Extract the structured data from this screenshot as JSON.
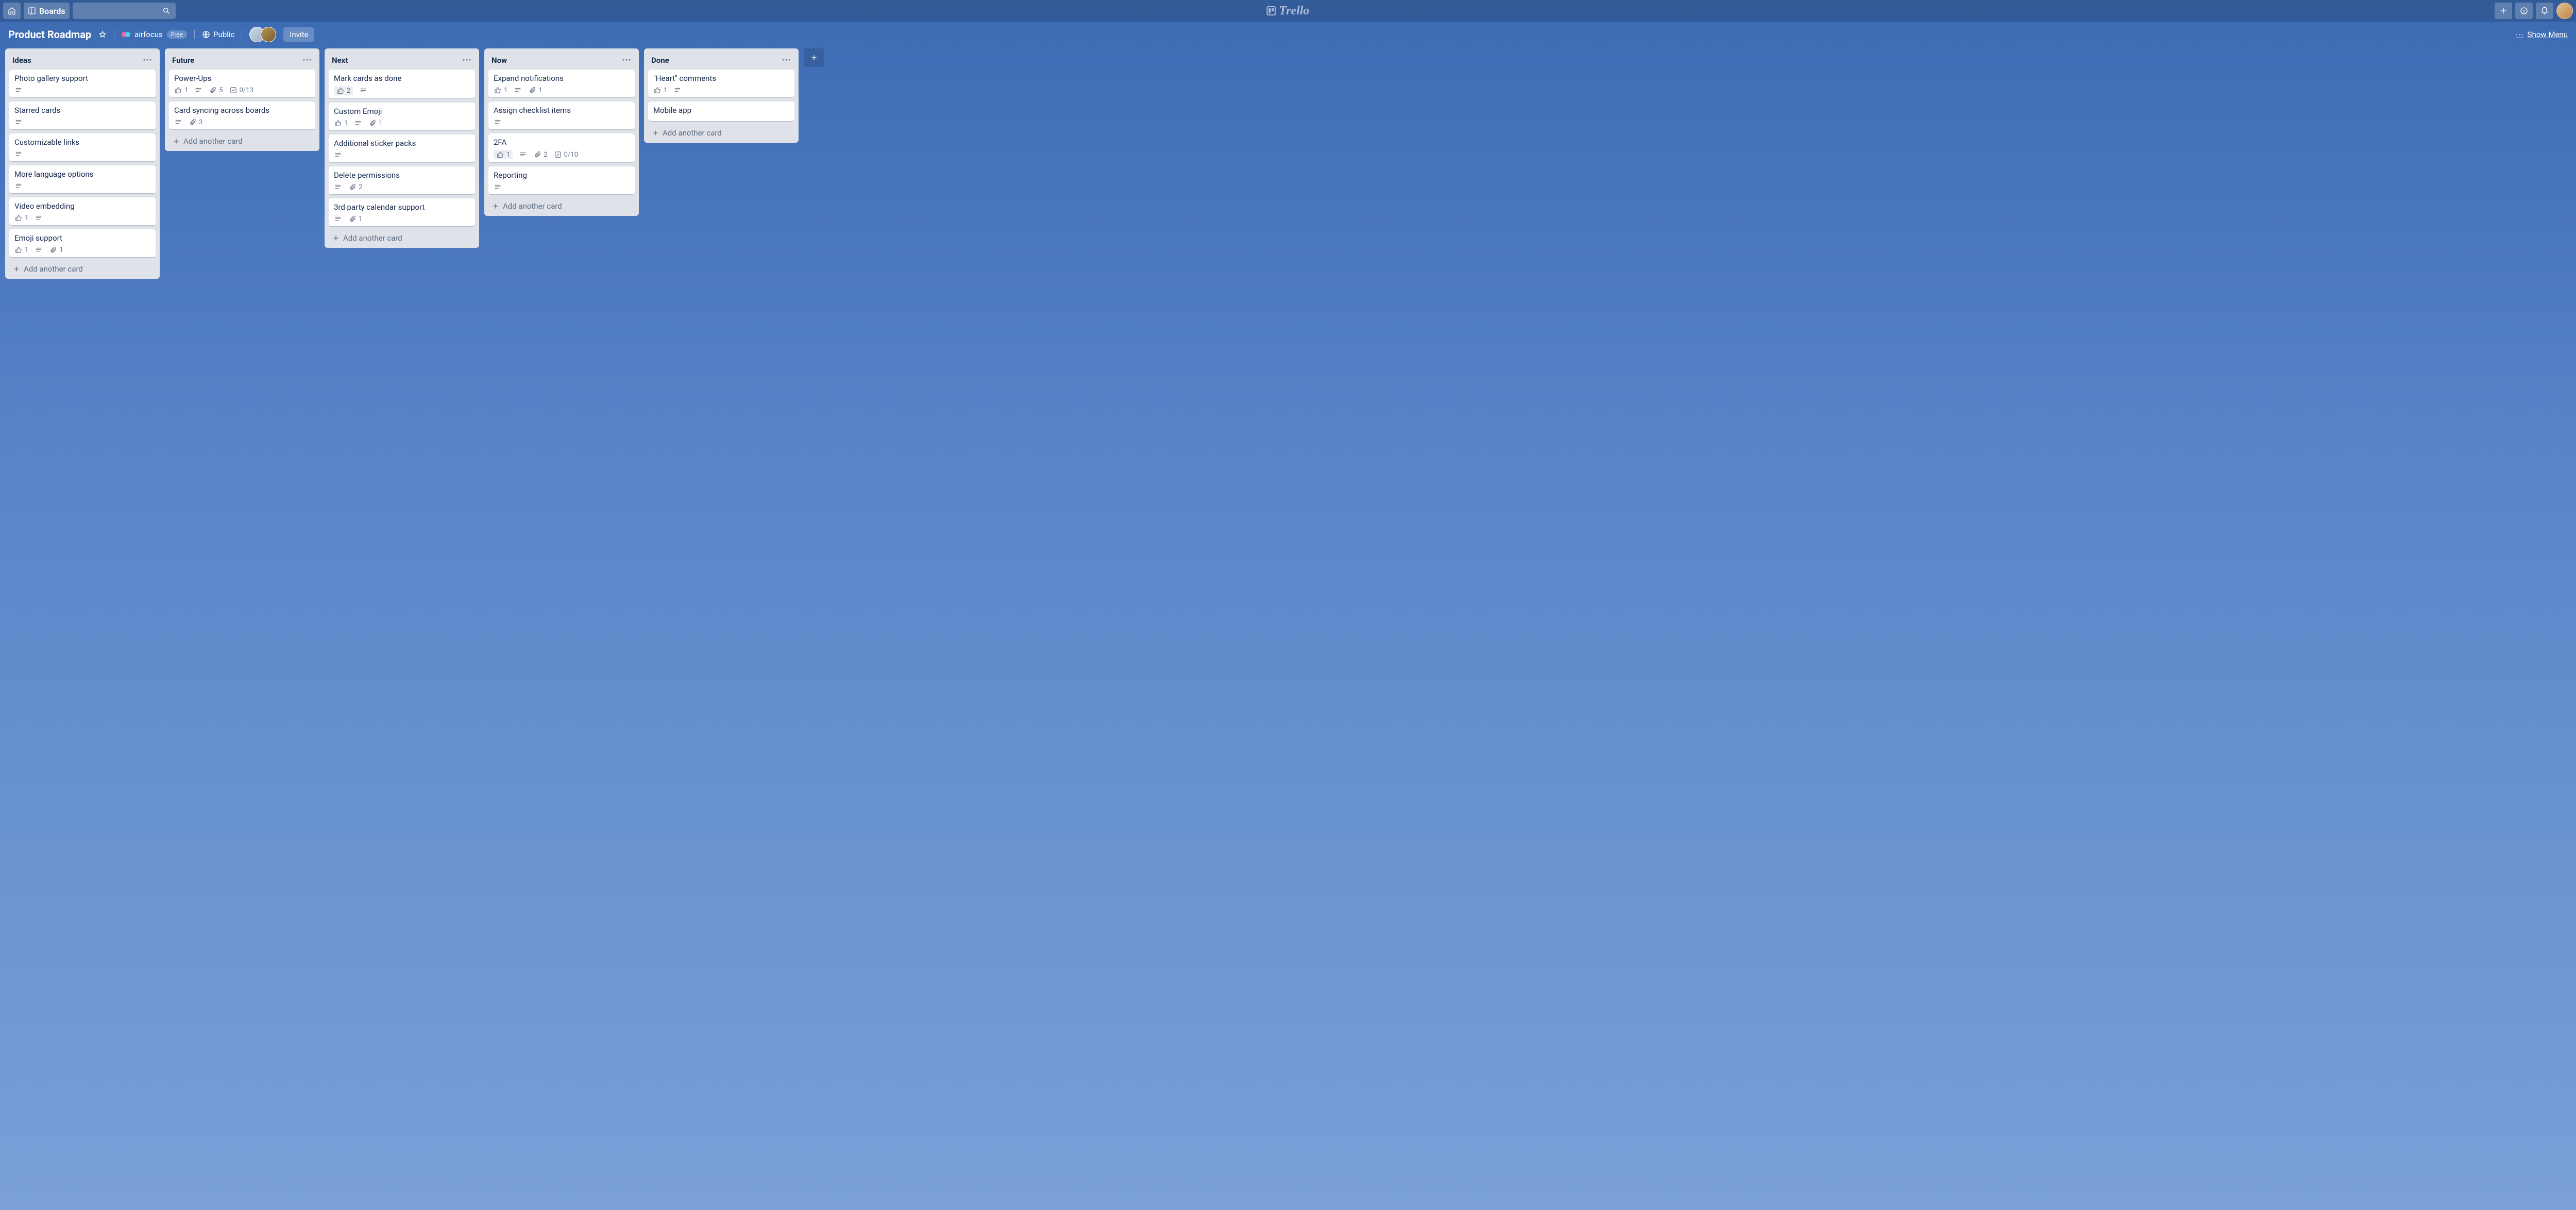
{
  "topbar": {
    "boards_label": "Boards",
    "brand": "Trello"
  },
  "board": {
    "title": "Product Roadmap",
    "team_name": "airfocus",
    "team_plan": "Free",
    "visibility": "Public",
    "invite_label": "Invite",
    "show_menu_label": "Show Menu"
  },
  "add_card_label": "Add another card",
  "lists": [
    {
      "name": "Ideas",
      "cards": [
        {
          "title": "Photo gallery support",
          "desc": true
        },
        {
          "title": "Starred cards",
          "desc": true
        },
        {
          "title": "Customizable links",
          "desc": true
        },
        {
          "title": "More language options",
          "desc": true
        },
        {
          "title": "Video embedding",
          "votes": 1,
          "desc": true
        },
        {
          "title": "Emoji support",
          "votes": 1,
          "desc": true,
          "attachments": 1
        }
      ]
    },
    {
      "name": "Future",
      "cards": [
        {
          "title": "Power-Ups",
          "votes": 1,
          "desc": true,
          "attachments": 5,
          "checklist": "0/13"
        },
        {
          "title": "Card syncing across boards",
          "desc": true,
          "attachments": 3
        }
      ]
    },
    {
      "name": "Next",
      "cards": [
        {
          "title": "Mark cards as done",
          "votes": 2,
          "voted": true,
          "desc": true
        },
        {
          "title": "Custom Emoji",
          "votes": 1,
          "desc": true,
          "attachments": 1
        },
        {
          "title": "Additional sticker packs",
          "desc": true
        },
        {
          "title": "Delete permissions",
          "desc": true,
          "attachments": 2
        },
        {
          "title": "3rd party calendar support",
          "desc": true,
          "attachments": 1
        }
      ]
    },
    {
      "name": "Now",
      "cards": [
        {
          "title": "Expand notifications",
          "votes": 1,
          "desc": true,
          "attachments": 1
        },
        {
          "title": "Assign checklist items",
          "desc": true
        },
        {
          "title": "2FA",
          "votes": 1,
          "voted": true,
          "desc": true,
          "attachments": 2,
          "checklist": "0/10"
        },
        {
          "title": "Reporting",
          "desc": true
        }
      ]
    },
    {
      "name": "Done",
      "cards": [
        {
          "title": "\"Heart\" comments",
          "votes": 1,
          "desc": true
        },
        {
          "title": "Mobile app"
        }
      ]
    }
  ]
}
